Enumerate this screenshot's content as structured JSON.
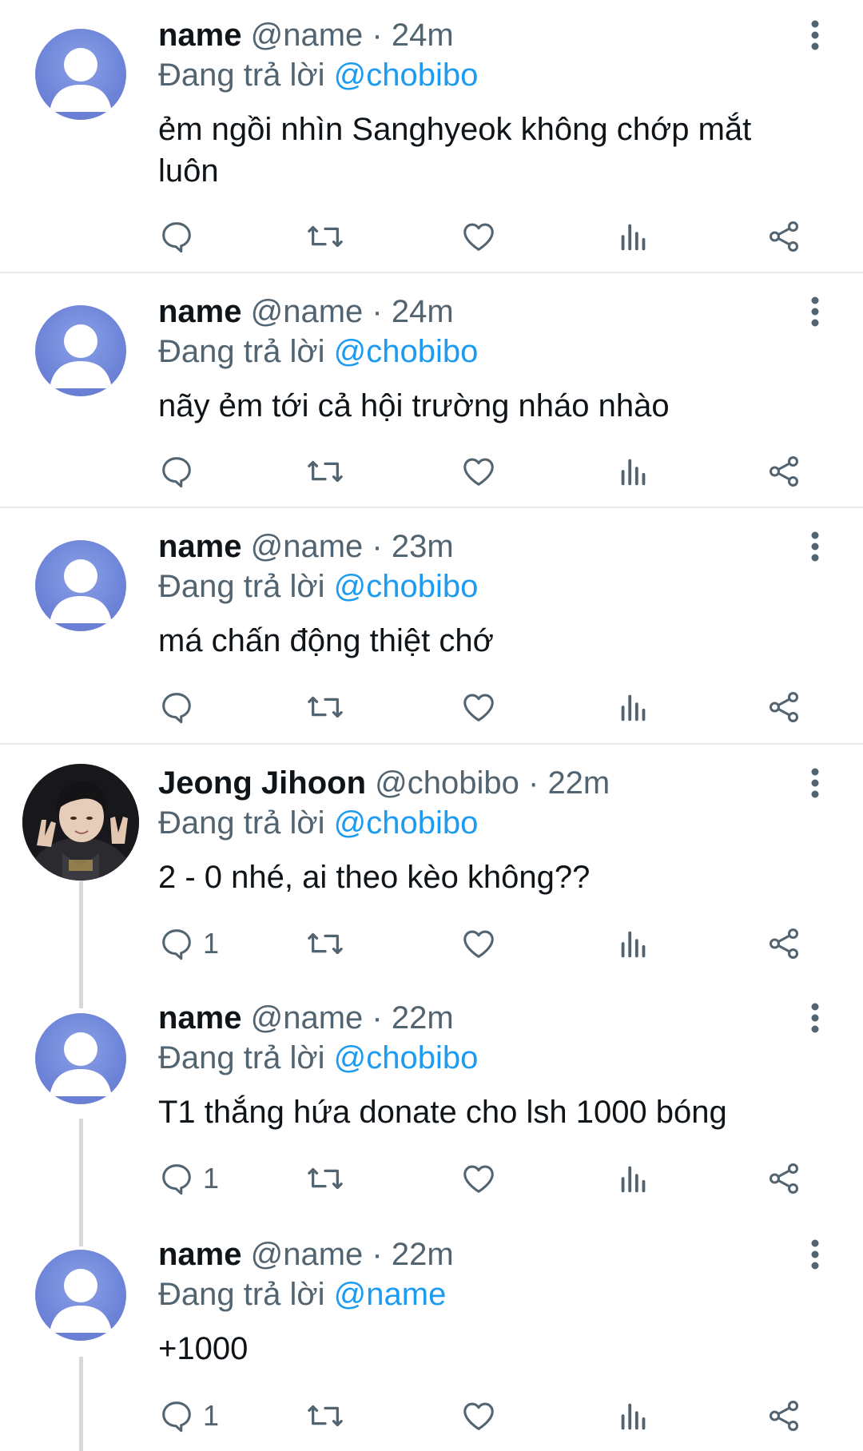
{
  "colors": {
    "accent": "#1d9bf0",
    "text_primary": "#0f1419",
    "text_secondary": "#536471",
    "avatar_default": "#6e84d8",
    "divider": "#e6e9ec"
  },
  "icons": {
    "reply": "reply-icon",
    "retweet": "retweet-icon",
    "like": "heart-icon",
    "views": "bar-chart-icon",
    "share": "share-icon",
    "more": "more-vertical-icon"
  },
  "tweets": [
    {
      "display_name": "name",
      "handle": "@name",
      "separator": "·",
      "time": "24m",
      "reply_prefix": "Đang trả lời",
      "reply_to": "@chobibo",
      "text": "ẻm ngồi nhìn Sanghyeok không chớp mắt luôn",
      "reply_count": ""
    },
    {
      "display_name": "name",
      "handle": "@name",
      "separator": "·",
      "time": "24m",
      "reply_prefix": "Đang trả lời",
      "reply_to": "@chobibo",
      "text": "nãy ẻm tới cả hội trường nháo nhào",
      "reply_count": ""
    },
    {
      "display_name": "name",
      "handle": "@name",
      "separator": "·",
      "time": "23m",
      "reply_prefix": "Đang trả lời",
      "reply_to": "@chobibo",
      "text": "má chấn động thiệt chớ",
      "reply_count": ""
    },
    {
      "display_name": "Jeong Jihoon",
      "handle": "@chobibo",
      "separator": "·",
      "time": "22m",
      "reply_prefix": "Đang trả lời",
      "reply_to": "@chobibo",
      "text": "2 - 0 nhé, ai theo kèo không??",
      "reply_count": "1"
    },
    {
      "display_name": "name",
      "handle": "@name",
      "separator": "·",
      "time": "22m",
      "reply_prefix": "Đang trả lời",
      "reply_to": "@chobibo",
      "text": "T1 thắng hứa donate cho lsh 1000 bóng",
      "reply_count": "1"
    },
    {
      "display_name": "name",
      "handle": "@name",
      "separator": "·",
      "time": "22m",
      "reply_prefix": "Đang trả lời",
      "reply_to": "@name",
      "text": "+1000",
      "reply_count": "1"
    }
  ]
}
